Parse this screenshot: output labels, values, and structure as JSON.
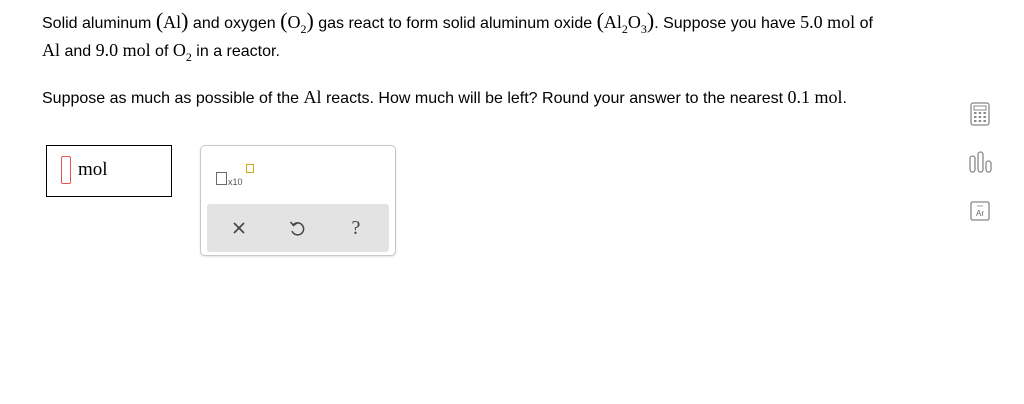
{
  "question": {
    "line1_a": "Solid aluminum ",
    "al_symbol": "Al",
    "line1_b": " and oxygen ",
    "o_symbol": "O",
    "o2_sub": "2",
    "line1_c": " gas react to form solid aluminum oxide ",
    "al_sym2": "Al",
    "al2o3_sub1": "2",
    "o_sym2": "O",
    "al2o3_sub2": "3",
    "line1_d": ". Suppose you have ",
    "al_amount": "5.0 mol",
    "line1_e": " of",
    "line2_al": "Al",
    "line2_a": " and ",
    "o2_amount": "9.0 mol",
    "line2_b": " of ",
    "line2_o": "O",
    "line2_sub": "2",
    "line2_c": " in a reactor.",
    "prompt_a": "Suppose as much as possible of the ",
    "prompt_al": "Al",
    "prompt_b": " reacts. How much will be left? Round your answer to the nearest ",
    "prompt_precision": "0.1 mol",
    "prompt_c": "."
  },
  "answer": {
    "unit": "mol"
  },
  "palette": {
    "sci_label": "x10",
    "clear_symbol": "×",
    "help_symbol": "?"
  },
  "side_tools": {
    "icons": [
      "calculator-icon",
      "data-chart-icon",
      "periodic-table-icon"
    ],
    "ptable_text": "Ar"
  },
  "colors": {
    "input_border": "#e15454",
    "sci_accent": "#c8a820",
    "palette_bar": "#e3e3e3"
  }
}
